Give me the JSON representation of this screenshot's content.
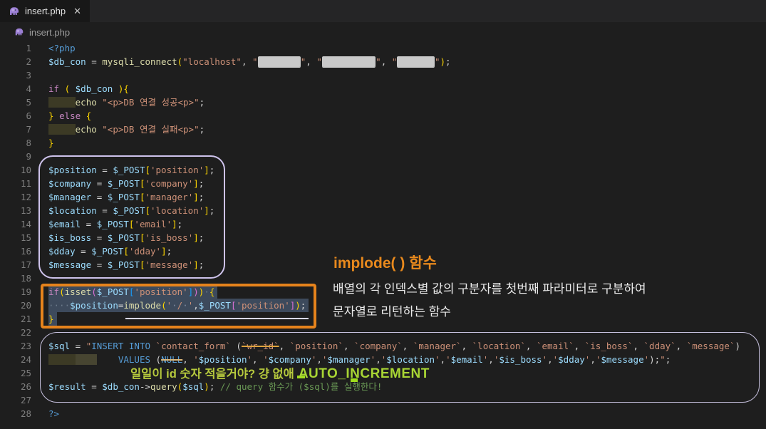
{
  "tab": {
    "title": "insert.php",
    "close_icon": "✕"
  },
  "breadcrumb": {
    "title": "insert.php"
  },
  "annotations": {
    "implode_title": "implode( ) 함수",
    "implode_desc1": "배열의 각 인덱스별 값의 구분자를 첫번째 파라미터로 구분하여",
    "implode_desc2": "문자열로 리턴하는 함수",
    "line25_text": "일일이 id 숫자 적을거야? 걍 없애",
    "line25_bold": "AUTO_INCREMENT"
  },
  "colors": {
    "editor_bg": "#1e1e1e",
    "tabstrip_bg": "#252526",
    "tab_bg": "#181818",
    "purple_box": "#cec3ec",
    "orange_box": "#e6831c",
    "bottom_box": "#c7c1de",
    "selection": "#3d4a5c",
    "annotation_yellow_green": "#b6c93d",
    "annotation_bright_green": "#a8d534",
    "annotation_orange": "#e8891d",
    "redaction_gray": "#c9c9c9",
    "php_icon_purple": "#9b7fd4"
  },
  "code": {
    "lines": [
      {
        "n": 1,
        "segs": [
          [
            "kwblue",
            "<?php"
          ]
        ]
      },
      {
        "n": 2,
        "segs": [
          [
            "var",
            "$db_con"
          ],
          [
            "op",
            " = "
          ],
          [
            "fn",
            "mysqli_connect"
          ],
          [
            "b1",
            "("
          ],
          [
            "str",
            "\"localhost\""
          ],
          [
            "op",
            ", "
          ],
          [
            "str",
            "\""
          ],
          [
            "redact",
            "        "
          ],
          [
            "str",
            "\""
          ],
          [
            "op",
            ", "
          ],
          [
            "str",
            "\""
          ],
          [
            "redact",
            "          "
          ],
          [
            "str",
            "\""
          ],
          [
            "op",
            ", "
          ],
          [
            "str",
            "\""
          ],
          [
            "redact",
            "       "
          ],
          [
            "str",
            "\""
          ],
          [
            "b1",
            ")"
          ],
          [
            "op",
            ";"
          ]
        ]
      },
      {
        "n": 3,
        "segs": []
      },
      {
        "n": 4,
        "segs": [
          [
            "kw",
            "if"
          ],
          [
            "op",
            " "
          ],
          [
            "b1",
            "( "
          ],
          [
            "var",
            "$db_con"
          ],
          [
            "op",
            " "
          ],
          [
            "b1",
            ")"
          ],
          [
            "b1",
            "{"
          ]
        ]
      },
      {
        "n": 5,
        "segs": [
          [
            "ind1",
            "     "
          ],
          [
            "fn",
            "echo"
          ],
          [
            "op",
            " "
          ],
          [
            "str",
            "\"<p>DB 연결 성공<p>\""
          ],
          [
            "op",
            ";"
          ]
        ]
      },
      {
        "n": 6,
        "segs": [
          [
            "b1",
            "} "
          ],
          [
            "kw",
            "else"
          ],
          [
            "op",
            " "
          ],
          [
            "b1",
            "{"
          ]
        ]
      },
      {
        "n": 7,
        "segs": [
          [
            "ind1",
            "     "
          ],
          [
            "fn",
            "echo"
          ],
          [
            "op",
            " "
          ],
          [
            "str",
            "\"<p>DB 연결 실패<p>\""
          ],
          [
            "op",
            ";"
          ]
        ]
      },
      {
        "n": 8,
        "segs": [
          [
            "b1",
            "}"
          ]
        ]
      },
      {
        "n": 9,
        "segs": []
      },
      {
        "n": 10,
        "segs": [
          [
            "var",
            "$position"
          ],
          [
            "op",
            " = "
          ],
          [
            "var",
            "$_POST"
          ],
          [
            "b1",
            "["
          ],
          [
            "str",
            "'position'"
          ],
          [
            "b1",
            "]"
          ],
          [
            "op",
            ";"
          ]
        ]
      },
      {
        "n": 11,
        "segs": [
          [
            "var",
            "$company"
          ],
          [
            "op",
            " = "
          ],
          [
            "var",
            "$_POST"
          ],
          [
            "b1",
            "["
          ],
          [
            "str",
            "'company'"
          ],
          [
            "b1",
            "]"
          ],
          [
            "op",
            ";"
          ]
        ]
      },
      {
        "n": 12,
        "segs": [
          [
            "var",
            "$manager"
          ],
          [
            "op",
            " = "
          ],
          [
            "var",
            "$_POST"
          ],
          [
            "b1",
            "["
          ],
          [
            "str",
            "'manager'"
          ],
          [
            "b1",
            "]"
          ],
          [
            "op",
            ";"
          ]
        ]
      },
      {
        "n": 13,
        "segs": [
          [
            "var",
            "$location"
          ],
          [
            "op",
            " = "
          ],
          [
            "var",
            "$_POST"
          ],
          [
            "b1",
            "["
          ],
          [
            "str",
            "'location'"
          ],
          [
            "b1",
            "]"
          ],
          [
            "op",
            ";"
          ]
        ]
      },
      {
        "n": 14,
        "segs": [
          [
            "var",
            "$email"
          ],
          [
            "op",
            " = "
          ],
          [
            "var",
            "$_POST"
          ],
          [
            "b1",
            "["
          ],
          [
            "str",
            "'email'"
          ],
          [
            "b1",
            "]"
          ],
          [
            "op",
            ";"
          ]
        ]
      },
      {
        "n": 15,
        "segs": [
          [
            "var",
            "$is_boss"
          ],
          [
            "op",
            " = "
          ],
          [
            "var",
            "$_POST"
          ],
          [
            "b1",
            "["
          ],
          [
            "str",
            "'is_boss'"
          ],
          [
            "b1",
            "]"
          ],
          [
            "op",
            ";"
          ]
        ]
      },
      {
        "n": 16,
        "segs": [
          [
            "var",
            "$dday"
          ],
          [
            "op",
            " = "
          ],
          [
            "var",
            "$_POST"
          ],
          [
            "b1",
            "["
          ],
          [
            "str",
            "'dday'"
          ],
          [
            "b1",
            "]"
          ],
          [
            "op",
            ";"
          ]
        ]
      },
      {
        "n": 17,
        "segs": [
          [
            "var",
            "$message"
          ],
          [
            "op",
            " = "
          ],
          [
            "var",
            "$_POST"
          ],
          [
            "b1",
            "["
          ],
          [
            "str",
            "'message'"
          ],
          [
            "b1",
            "]"
          ],
          [
            "op",
            ";"
          ]
        ]
      },
      {
        "n": 18,
        "segs": []
      },
      {
        "n": 19,
        "sel": true,
        "segs": [
          [
            "kw",
            "if"
          ],
          [
            "b1",
            "("
          ],
          [
            "fn",
            "isset"
          ],
          [
            "b2",
            "("
          ],
          [
            "var",
            "$_POST"
          ],
          [
            "b3",
            "["
          ],
          [
            "str",
            "'position'"
          ],
          [
            "b3",
            "]"
          ],
          [
            "b2",
            ")"
          ],
          [
            "b1",
            ")"
          ],
          [
            "ws",
            "·"
          ],
          [
            "b1",
            "{"
          ]
        ]
      },
      {
        "n": 20,
        "sel": true,
        "segs": [
          [
            "ws",
            "····"
          ],
          [
            "var",
            "$position"
          ],
          [
            "op",
            "="
          ],
          [
            "fn",
            "implode"
          ],
          [
            "b1",
            "("
          ],
          [
            "str",
            "'"
          ],
          [
            "wsd",
            "·"
          ],
          [
            "str",
            "/"
          ],
          [
            "wsd",
            "·"
          ],
          [
            "str",
            "'"
          ],
          [
            "op",
            ","
          ],
          [
            "var",
            "$_POST"
          ],
          [
            "b2",
            "["
          ],
          [
            "str",
            "'position'"
          ],
          [
            "b2",
            "]"
          ],
          [
            "b1",
            ")"
          ],
          [
            "op",
            ";"
          ]
        ]
      },
      {
        "n": 21,
        "sel": true,
        "segs": [
          [
            "b1",
            "}"
          ]
        ]
      },
      {
        "n": 22,
        "segs": []
      },
      {
        "n": 23,
        "segs": [
          [
            "var",
            "$sql"
          ],
          [
            "op",
            " = "
          ],
          [
            "str",
            "\""
          ],
          [
            "sqlkw",
            "INSERT"
          ],
          [
            "str",
            " "
          ],
          [
            "sqlkw",
            "INTO"
          ],
          [
            "str",
            " "
          ],
          [
            "strq",
            "`contact_form`"
          ],
          [
            "op",
            " ("
          ],
          [
            "strikeg",
            "`wr_id`"
          ],
          [
            "op",
            ", "
          ],
          [
            "strq",
            "`position`"
          ],
          [
            "op",
            ", "
          ],
          [
            "strq",
            "`company`"
          ],
          [
            "op",
            ", "
          ],
          [
            "strq",
            "`manager`"
          ],
          [
            "op",
            ", "
          ],
          [
            "strq",
            "`location`"
          ],
          [
            "op",
            ", "
          ],
          [
            "strq",
            "`email`"
          ],
          [
            "op",
            ", "
          ],
          [
            "strq",
            "`is_boss`"
          ],
          [
            "op",
            ", "
          ],
          [
            "strq",
            "`dday`"
          ],
          [
            "op",
            ", "
          ],
          [
            "strq",
            "`message`"
          ],
          [
            "op",
            ")"
          ]
        ]
      },
      {
        "n": 24,
        "segs": [
          [
            "ind1",
            "     "
          ],
          [
            "ind2",
            "    "
          ],
          [
            "op",
            "    "
          ],
          [
            "sqlkw",
            "VALUES"
          ],
          [
            "op",
            " ("
          ],
          [
            "strikeb",
            "NULL"
          ],
          [
            "op",
            ", "
          ],
          [
            "str",
            "'"
          ],
          [
            "var",
            "$position"
          ],
          [
            "str",
            "'"
          ],
          [
            "op",
            ", "
          ],
          [
            "str",
            "'"
          ],
          [
            "var",
            "$company"
          ],
          [
            "str",
            "'"
          ],
          [
            "op",
            ","
          ],
          [
            "str",
            "'"
          ],
          [
            "var",
            "$manager"
          ],
          [
            "str",
            "'"
          ],
          [
            "op",
            ","
          ],
          [
            "str",
            "'"
          ],
          [
            "var",
            "$location"
          ],
          [
            "str",
            "'"
          ],
          [
            "op",
            ","
          ],
          [
            "str",
            "'"
          ],
          [
            "var",
            "$email"
          ],
          [
            "str",
            "'"
          ],
          [
            "op",
            ","
          ],
          [
            "str",
            "'"
          ],
          [
            "var",
            "$is_boss"
          ],
          [
            "str",
            "'"
          ],
          [
            "op",
            ","
          ],
          [
            "str",
            "'"
          ],
          [
            "var",
            "$dday"
          ],
          [
            "str",
            "'"
          ],
          [
            "op",
            ","
          ],
          [
            "str",
            "'"
          ],
          [
            "var",
            "$message"
          ],
          [
            "str",
            "'"
          ],
          [
            "op",
            ");"
          ],
          [
            "str",
            "\""
          ],
          [
            "op",
            ";"
          ]
        ]
      },
      {
        "n": 25,
        "segs": []
      },
      {
        "n": 26,
        "segs": [
          [
            "var",
            "$result"
          ],
          [
            "op",
            " = "
          ],
          [
            "var",
            "$db_con"
          ],
          [
            "op",
            "->"
          ],
          [
            "fn",
            "query"
          ],
          [
            "b1",
            "("
          ],
          [
            "var",
            "$sql"
          ],
          [
            "b1",
            ")"
          ],
          [
            "op",
            "; "
          ],
          [
            "cmt",
            "// query 함수가 ($sql)를 실행한다!"
          ]
        ]
      },
      {
        "n": 27,
        "segs": []
      },
      {
        "n": 28,
        "segs": [
          [
            "kwblue",
            "?>"
          ]
        ]
      }
    ]
  }
}
